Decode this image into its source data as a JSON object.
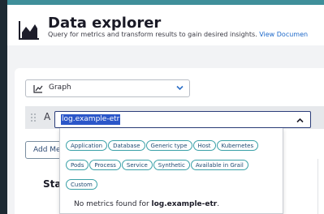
{
  "header": {
    "title": "Data explorer",
    "subtitle": "Query for metrics and transform results to gain desired insights.",
    "doc_link": "View Documen",
    "icon": "area-chart-icon"
  },
  "visualization": {
    "selected": "Graph",
    "icon": "line-chart-icon"
  },
  "query": {
    "letter": "A",
    "metric_value": "log.example-etr"
  },
  "add_metric_label": "Add Me",
  "section_heading": "Sta",
  "dropdown": {
    "chips": [
      "Application",
      "Database",
      "Generic type",
      "Host",
      "Kubernetes",
      "Pods",
      "Process",
      "Service",
      "Synthetic",
      "Available in Grail",
      "Custom"
    ],
    "no_results_prefix": "No metrics found for ",
    "no_results_term": "log.example-etr",
    "no_results_suffix": "."
  },
  "colors": {
    "accent": "#3f8f9a",
    "chip_border": "#3aa1a8",
    "selection": "#2b56c9",
    "link": "#1c68c9"
  }
}
